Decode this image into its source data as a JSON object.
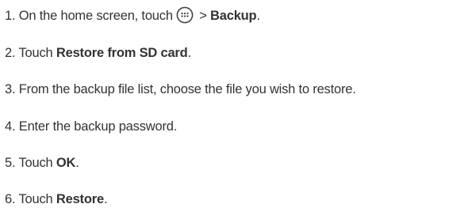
{
  "steps": [
    {
      "number": "1.",
      "text_before": "On the home screen, touch",
      "icon": "apps-grid-icon",
      "text_after": " > ",
      "bold": "Backup",
      "text_end": "."
    },
    {
      "number": "2.",
      "text_before": "Touch ",
      "bold": "Restore from SD card",
      "text_end": "."
    },
    {
      "number": "3.",
      "text": "From the backup file list, choose the file you wish to restore."
    },
    {
      "number": "4.",
      "text": "Enter the backup password."
    },
    {
      "number": "5.",
      "text_before": "Touch ",
      "bold": "OK",
      "text_end": "."
    },
    {
      "number": "6.",
      "text_before": "Touch ",
      "bold": "Restore",
      "text_end": "."
    }
  ],
  "colors": {
    "text": "#333333",
    "icon_stroke": "#444444"
  }
}
